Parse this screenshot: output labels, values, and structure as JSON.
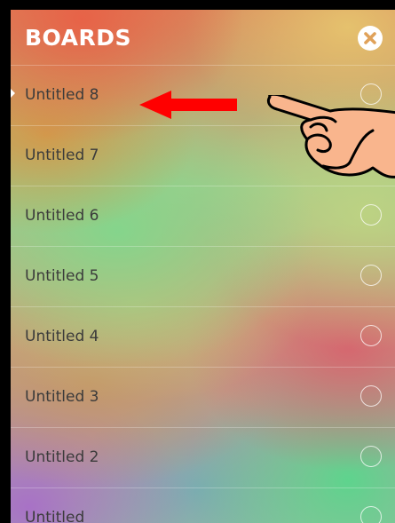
{
  "header": {
    "title": "BOARDS",
    "close_icon": "close-circle-icon"
  },
  "boards": [
    {
      "label": "Untitled 8",
      "selected": true
    },
    {
      "label": "Untitled 7",
      "selected": false
    },
    {
      "label": "Untitled 6",
      "selected": false
    },
    {
      "label": "Untitled 5",
      "selected": false
    },
    {
      "label": "Untitled 4",
      "selected": false
    },
    {
      "label": "Untitled 3",
      "selected": false
    },
    {
      "label": "Untitled 2",
      "selected": false
    },
    {
      "label": "Untitled",
      "selected": false
    }
  ],
  "annotations": {
    "arrow_icon": "left-arrow-icon",
    "arrow_color": "#ff0000",
    "hand_icon": "pointing-hand-icon",
    "hand_color": "#f9b58d"
  }
}
